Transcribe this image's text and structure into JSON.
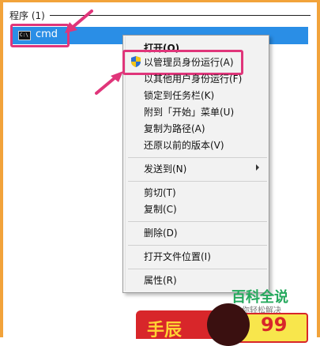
{
  "section": {
    "title": "程序 (1)"
  },
  "result": {
    "label": "cmd",
    "icon": "cmd-console-icon"
  },
  "menu": {
    "open": "打开(O)",
    "run_as_admin": "以管理员身份运行(A)",
    "run_as_other": "以其他用户身份运行(F)",
    "pin_taskbar": "锁定到任务栏(K)",
    "pin_start": "附到「开始」菜单(U)",
    "copy_path": "复制为路径(A)",
    "restore": "还原以前的版本(V)",
    "send_to": "发送到(N)",
    "cut": "剪切(T)",
    "copy": "复制(C)",
    "delete": "删除(D)",
    "open_location": "打开文件位置(I)",
    "properties": "属性(R)"
  },
  "watermark": {
    "title": "百科全说",
    "subtitle": "助你轻松解决"
  },
  "banner": {
    "text": "手辰",
    "number": "99"
  },
  "colors": {
    "highlight": "#2a8ee6",
    "callout": "#e0357a",
    "frame": "#f2a33a"
  }
}
